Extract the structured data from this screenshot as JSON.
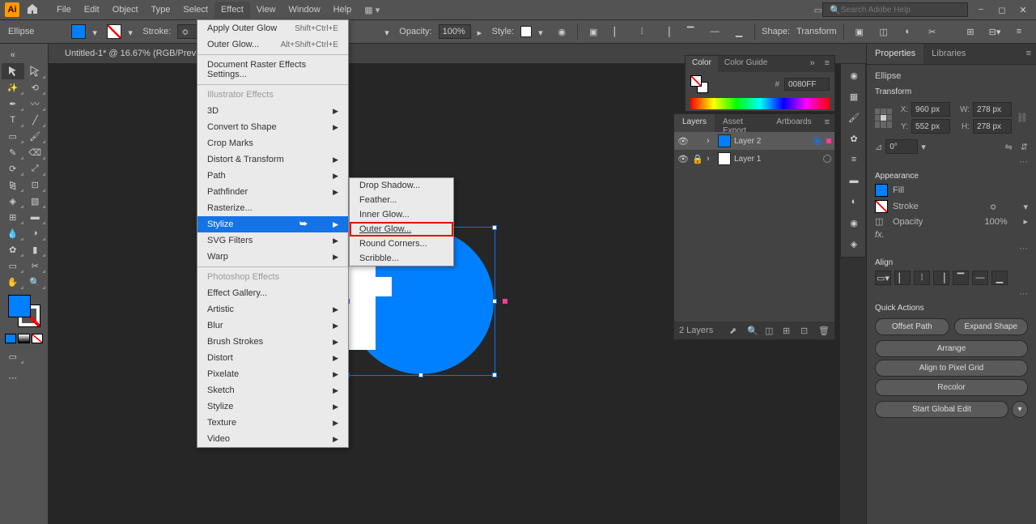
{
  "app": {
    "name": "Ai"
  },
  "menubar": {
    "items": [
      "File",
      "Edit",
      "Object",
      "Type",
      "Select",
      "Effect",
      "View",
      "Window",
      "Help"
    ],
    "open_index": 5,
    "search_placeholder": "Search Adobe Help"
  },
  "controlbar": {
    "shape_label": "Ellipse",
    "stroke_label": "Stroke:",
    "opacity_label": "Opacity:",
    "opacity_value": "100%",
    "style_label": "Style:",
    "shape_btn": "Shape:",
    "transform_btn": "Transform"
  },
  "doc_tab": "Untitled-1* @ 16.67% (RGB/Preview)",
  "effect_menu": {
    "apply": {
      "label": "Apply Outer Glow",
      "shortcut": "Shift+Ctrl+E"
    },
    "last": {
      "label": "Outer Glow...",
      "shortcut": "Alt+Shift+Ctrl+E"
    },
    "raster_settings": "Document Raster Effects Settings...",
    "section_illustrator": "Illustrator Effects",
    "illus_items": [
      {
        "label": "3D",
        "sub": true
      },
      {
        "label": "Convert to Shape",
        "sub": true
      },
      {
        "label": "Crop Marks",
        "sub": false
      },
      {
        "label": "Distort & Transform",
        "sub": true
      },
      {
        "label": "Path",
        "sub": true
      },
      {
        "label": "Pathfinder",
        "sub": true
      },
      {
        "label": "Rasterize...",
        "sub": false
      },
      {
        "label": "Stylize",
        "sub": true,
        "hl": true
      },
      {
        "label": "SVG Filters",
        "sub": true
      },
      {
        "label": "Warp",
        "sub": true
      }
    ],
    "section_ps": "Photoshop Effects",
    "ps_items": [
      {
        "label": "Effect Gallery...",
        "sub": false
      },
      {
        "label": "Artistic",
        "sub": true
      },
      {
        "label": "Blur",
        "sub": true
      },
      {
        "label": "Brush Strokes",
        "sub": true
      },
      {
        "label": "Distort",
        "sub": true
      },
      {
        "label": "Pixelate",
        "sub": true
      },
      {
        "label": "Sketch",
        "sub": true
      },
      {
        "label": "Stylize",
        "sub": true
      },
      {
        "label": "Texture",
        "sub": true
      },
      {
        "label": "Video",
        "sub": true
      }
    ]
  },
  "stylize_submenu": {
    "items": [
      "Drop Shadow...",
      "Feather...",
      "Inner Glow...",
      "Outer Glow...",
      "Round Corners...",
      "Scribble..."
    ],
    "highlight_index": 3
  },
  "color_panel": {
    "tabs": [
      "Color",
      "Color Guide"
    ],
    "hex": "0080FF"
  },
  "layers_panel": {
    "tabs": [
      "Layers",
      "Asset Export",
      "Artboards"
    ],
    "layers": [
      {
        "name": "Layer 2",
        "thumb_bg": "#0080ff",
        "selected": true,
        "locked": false
      },
      {
        "name": "Layer 1",
        "thumb_bg": "#ffffff",
        "selected": false,
        "locked": true
      }
    ],
    "footer_count": "2 Layers"
  },
  "properties": {
    "tabs": [
      "Properties",
      "Libraries"
    ],
    "shape": "Ellipse",
    "transform_title": "Transform",
    "x": "960 px",
    "y": "552 px",
    "w": "278 px",
    "h": "278 px",
    "angle": "0°",
    "appearance_title": "Appearance",
    "fill_label": "Fill",
    "stroke_label": "Stroke",
    "opacity_label": "Opacity",
    "opacity_value": "100%",
    "fx_label": "fx.",
    "align_title": "Align",
    "quick_title": "Quick Actions",
    "btn_offset": "Offset Path",
    "btn_expand": "Expand Shape",
    "btn_arrange": "Arrange",
    "btn_pixelgrid": "Align to Pixel Grid",
    "btn_recolor": "Recolor",
    "btn_global": "Start Global Edit"
  }
}
